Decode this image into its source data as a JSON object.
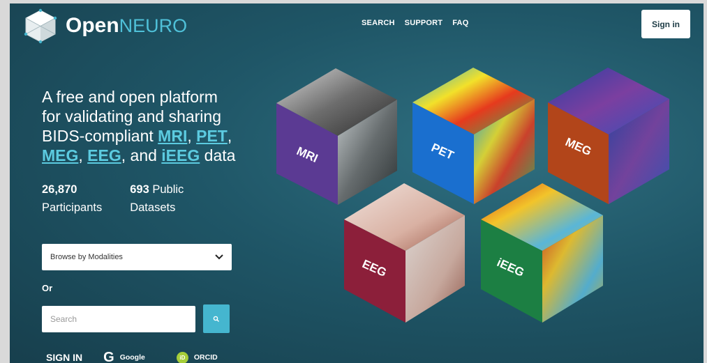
{
  "header": {
    "logo_bold": "Open",
    "logo_light": "NEURO",
    "nav": [
      "SEARCH",
      "SUPPORT",
      "FAQ"
    ],
    "signin_button": "Sign in"
  },
  "hero": {
    "line1": "A free and open platform",
    "line2": "for validating and sharing",
    "line3_prefix": "BIDS-compliant ",
    "mri": "MRI",
    "pet": "PET",
    "meg": "MEG",
    "eeg": "EEG",
    "and": ", and ",
    "ieeg": "iEEG",
    "data": " data",
    "comma": ",",
    "comma_space": ", "
  },
  "stats": {
    "participants_value": "26,870",
    "participants_label": "Participants",
    "datasets_value": "693",
    "datasets_label_inline": " Public",
    "datasets_label": "Datasets"
  },
  "browse": {
    "label": "Browse by Modalities"
  },
  "or_label": "Or",
  "search": {
    "placeholder": "Search"
  },
  "signin_row": {
    "label": "SIGN IN",
    "google": "Google",
    "google_glyph": "G",
    "orcid": "ORCID",
    "orcid_glyph": "iD"
  },
  "cubes": [
    {
      "label": "MRI",
      "color": "#5b3a93"
    },
    {
      "label": "PET",
      "color": "#1a6fcf"
    },
    {
      "label": "MEG",
      "color": "#b2451a"
    },
    {
      "label": "EEG",
      "color": "#8c1f3a"
    },
    {
      "label": "iEEG",
      "color": "#1c7f43"
    }
  ],
  "colors": {
    "accent": "#45b6cf",
    "link": "#5ccbe0",
    "background": "#1f5667"
  }
}
